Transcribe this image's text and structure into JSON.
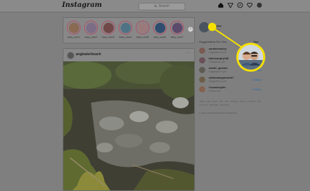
{
  "app": {
    "logo": "Instagram"
  },
  "search": {
    "placeholder": "Search"
  },
  "nav_icons": [
    "home-icon",
    "direct-messages-icon",
    "explore-icon",
    "activity-heart-icon",
    "profile-avatar-icon"
  ],
  "stories": [
    {
      "name": "story_user1"
    },
    {
      "name": "story_user2"
    },
    {
      "name": "story_user3"
    },
    {
      "name": "story_user4"
    },
    {
      "name": "story_user5"
    },
    {
      "name": "story_user6"
    },
    {
      "name": "story_user7"
    }
  ],
  "post": {
    "username": "angleaterbeach",
    "more": "···"
  },
  "profile": {
    "username": "lifewire",
    "name": "Lifewire"
  },
  "suggestions": {
    "title": "Suggestions For You",
    "see_all": "See All",
    "items": [
      {
        "name": "sarahmmarley",
        "subtitle": "Suggested for you",
        "follow": "Follow"
      },
      {
        "name": "katiemurphy180",
        "subtitle": "Followed by user",
        "follow": "Follow"
      },
      {
        "name": "martin_gedden",
        "subtitle": "Suggested for you",
        "follow": "Follow"
      },
      {
        "name": "wildbeautyphotos67",
        "subtitle": "Suggested for you",
        "follow": "Follow"
      },
      {
        "name": "i.hoodsmylife",
        "subtitle": "Follows you",
        "follow": "Follow"
      }
    ]
  },
  "footer": {
    "links": "About · Help · Press · API · Jobs · Privacy · Terms · Locations · Top Accounts · Hashtags · Language",
    "copyright": "© 2021 INSTAGRAM FROM FACEBOOK"
  },
  "colors": {
    "highlight": "#f5e000",
    "follow": "#3d6e9e",
    "story_ring": "#b0506a"
  }
}
